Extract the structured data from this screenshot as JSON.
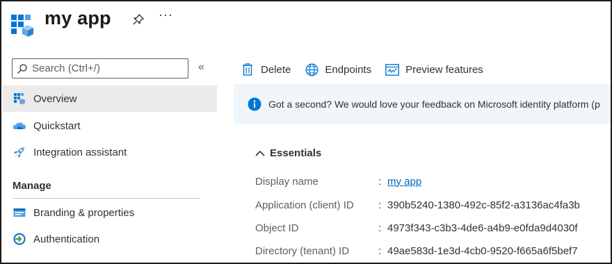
{
  "header": {
    "title": "my app",
    "logo_icon": "app-registration-icon",
    "pin_icon": "pin-icon",
    "more_label": "···"
  },
  "sidebar": {
    "search_placeholder": "Search (Ctrl+/)",
    "collapse_label": "«",
    "items": [
      {
        "label": "Overview",
        "icon": "overview-grid-icon",
        "active": true
      },
      {
        "label": "Quickstart",
        "icon": "cloud-icon"
      },
      {
        "label": "Integration assistant",
        "icon": "rocket-icon"
      }
    ],
    "manage_title": "Manage",
    "manage_items": [
      {
        "label": "Branding & properties",
        "icon": "branding-icon"
      },
      {
        "label": "Authentication",
        "icon": "authentication-icon"
      }
    ]
  },
  "toolbar": {
    "delete_label": "Delete",
    "endpoints_label": "Endpoints",
    "preview_label": "Preview features"
  },
  "banner": {
    "text": "Got a second? We would love your feedback on Microsoft identity platform (p"
  },
  "essentials": {
    "title": "Essentials",
    "rows": [
      {
        "key": "Display name",
        "value": "my app",
        "link": true
      },
      {
        "key": "Application (client) ID",
        "value": "390b5240-1380-492c-85f2-a3136ac4fa3b"
      },
      {
        "key": "Object ID",
        "value": "4973f343-c3b3-4de6-a4b9-e0fda9d4030f"
      },
      {
        "key": "Directory (tenant) ID",
        "value": "49ae583d-1e3d-4cb0-9520-f665a6f5bef7"
      }
    ]
  },
  "colors": {
    "accent": "#0078d4",
    "link": "#0067b8",
    "banner_bg": "#eff6fc",
    "active_nav_bg": "#edebe9"
  }
}
